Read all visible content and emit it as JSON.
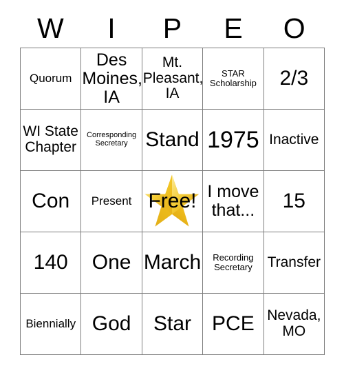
{
  "card": {
    "header_letters": [
      "W",
      "I",
      "P",
      "E",
      "O"
    ],
    "rows": [
      [
        {
          "text": "Quorum",
          "size": "md"
        },
        {
          "text": "Des Moines, IA",
          "size": "xl"
        },
        {
          "text": "Mt. Pleasant, IA",
          "size": "lg"
        },
        {
          "text": "STAR Scholarship",
          "size": "sm"
        },
        {
          "text": "2/3",
          "size": "xxl"
        }
      ],
      [
        {
          "text": "WI State Chapter",
          "size": "lg"
        },
        {
          "text": "Corresponding Secretary",
          "size": "xs"
        },
        {
          "text": "Stand",
          "size": "xxl"
        },
        {
          "text": "1975",
          "size": "huge"
        },
        {
          "text": "Inactive",
          "size": "lg"
        }
      ],
      [
        {
          "text": "Con",
          "size": "xxl"
        },
        {
          "text": "Present",
          "size": "md"
        },
        {
          "text": "Free!",
          "size": "xxl",
          "free_space": true,
          "icon": "gold-star-icon"
        },
        {
          "text": "I move that...",
          "size": "xl"
        },
        {
          "text": "15",
          "size": "xxl"
        }
      ],
      [
        {
          "text": "140",
          "size": "xxl"
        },
        {
          "text": "One",
          "size": "xxl"
        },
        {
          "text": "March",
          "size": "xxl"
        },
        {
          "text": "Recording Secretary",
          "size": "sm"
        },
        {
          "text": "Transfer",
          "size": "lg"
        }
      ],
      [
        {
          "text": "Biennially",
          "size": "md"
        },
        {
          "text": "God",
          "size": "xxl"
        },
        {
          "text": "Star",
          "size": "xxl"
        },
        {
          "text": "PCE",
          "size": "xxl"
        },
        {
          "text": "Nevada, MO",
          "size": "lg"
        }
      ]
    ],
    "colors": {
      "grid_line": "#7d7d7d",
      "text": "#000000",
      "background": "#ffffff",
      "star_gold_light": "#fbe27a",
      "star_gold": "#f3c41c",
      "star_gold_dark": "#d79c12"
    }
  }
}
